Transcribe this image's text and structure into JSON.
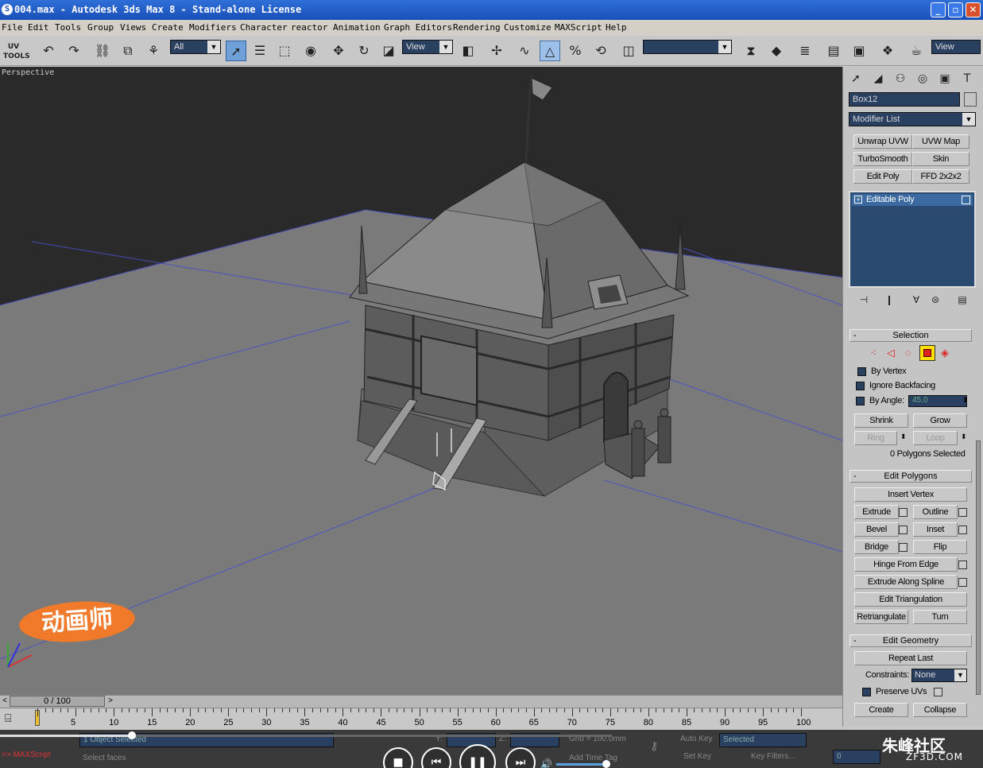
{
  "window": {
    "title": "004.max - Autodesk 3ds Max 8  - Stand-alone License",
    "app_icon": "3ds-max-icon",
    "controls": [
      "minimize",
      "maximize",
      "close"
    ]
  },
  "menu": [
    "File",
    "Edit",
    "Tools",
    "Group",
    "Views",
    "Create",
    "Modifiers",
    "Character",
    "reactor",
    "Animation",
    "Graph Editors",
    "Rendering",
    "Customize",
    "MAXScript",
    "Help"
  ],
  "toolbar": {
    "uv_tools_label": "UV",
    "uv_tools_sub": "TOOLS",
    "selection_filter": "All",
    "ref_coord": "View",
    "named_selection": "",
    "render_view": "View"
  },
  "viewport": {
    "label": "Perspective",
    "colors": {
      "background": "#2a2a2a",
      "ground": "#7a7a7a",
      "grid_line": "#4a50c8",
      "model": "#6b6b6b"
    }
  },
  "panel": {
    "object_name": "Box12",
    "object_color": "#111111",
    "modifier_list_label": "Modifier List",
    "modifier_buttons": [
      "Unwrap UVW",
      "UVW Map",
      "TurboSmooth",
      "Skin",
      "Edit Poly",
      "FFD 2x2x2"
    ],
    "stack_item": "Editable Poly",
    "selection": {
      "title": "Selection",
      "by_vertex": "By Vertex",
      "ignore_backfacing": "Ignore Backfacing",
      "by_angle": "By Angle:",
      "angle_value": "45.0",
      "shrink": "Shrink",
      "grow": "Grow",
      "ring": "Ring",
      "loop": "Loop",
      "status": "0 Polygons Selected"
    },
    "edit_polygons": {
      "title": "Edit Polygons",
      "insert_vertex": "Insert Vertex",
      "extrude": "Extrude",
      "outline": "Outline",
      "bevel": "Bevel",
      "inset": "Inset",
      "bridge": "Bridge",
      "flip": "Flip",
      "hinge_from_edge": "Hinge From Edge",
      "extrude_along_spline": "Extrude Along Spline",
      "edit_triangulation": "Edit Triangulation",
      "retriangulate": "Retriangulate",
      "turn": "Turn"
    },
    "edit_geometry": {
      "title": "Edit Geometry",
      "repeat_last": "Repeat Last",
      "constraints_label": "Constraints:",
      "constraints_value": "None",
      "preserve_uvs": "Preserve UVs",
      "create": "Create",
      "collapse": "Collapse"
    }
  },
  "timeline": {
    "frame_display": "0 / 100",
    "ticks": [
      "5",
      "10",
      "15",
      "20",
      "25",
      "30",
      "35",
      "40",
      "45",
      "50",
      "55",
      "60",
      "65",
      "70",
      "75",
      "80",
      "85",
      "90",
      "95",
      "100"
    ]
  },
  "status": {
    "maxscript": ">> MAXScript",
    "selected": "1 Object Selected",
    "prompt": "Select faces",
    "y_label": "Y:",
    "z_label": "Z:",
    "grid": "Grid = 100.0mm",
    "auto_key": "Auto Key",
    "selected_dd": "Selected",
    "set_key": "Set Key",
    "key_filters": "Key Filters...",
    "add_time_tag": "Add Time Tag",
    "frame": "0"
  },
  "watermark": {
    "logo_text": "动画师",
    "site_name": "朱峰社区",
    "site_url": "ZF3D.COM"
  }
}
